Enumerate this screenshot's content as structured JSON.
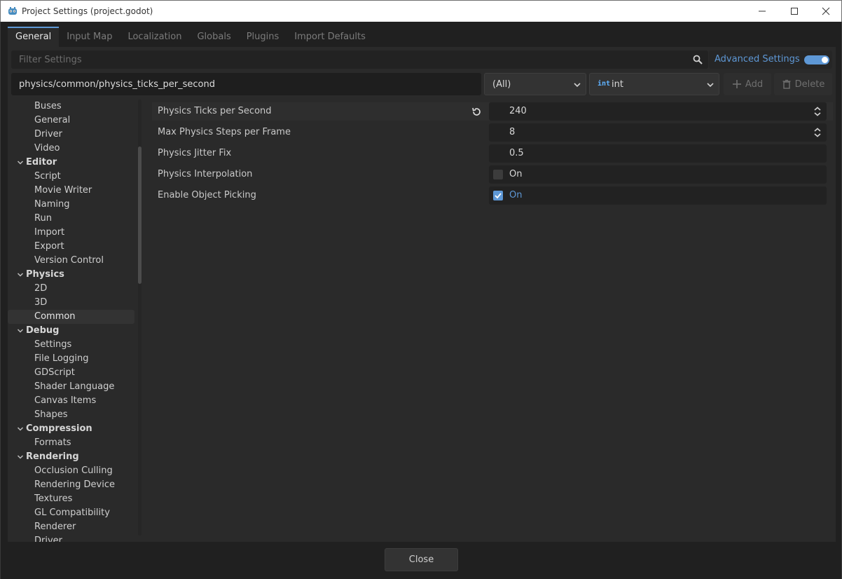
{
  "window": {
    "title": "Project Settings (project.godot)",
    "accent": "#5e98d6"
  },
  "tabs": [
    {
      "label": "General",
      "active": true
    },
    {
      "label": "Input Map"
    },
    {
      "label": "Localization"
    },
    {
      "label": "Globals"
    },
    {
      "label": "Plugins"
    },
    {
      "label": "Import Defaults"
    }
  ],
  "toolbar": {
    "filter_placeholder": "Filter Settings",
    "advanced_label": "Advanced Settings",
    "advanced_on": true,
    "path_value": "physics/common/physics_ticks_per_second",
    "filter_dropdown": "(All)",
    "type_icon": "int",
    "type_dropdown": "int",
    "add_label": "Add",
    "delete_label": "Delete"
  },
  "tree": [
    {
      "label": "Buses",
      "kind": "sub"
    },
    {
      "label": "General",
      "kind": "sub"
    },
    {
      "label": "Driver",
      "kind": "sub"
    },
    {
      "label": "Video",
      "kind": "sub"
    },
    {
      "label": "Editor",
      "kind": "cat"
    },
    {
      "label": "Script",
      "kind": "sub"
    },
    {
      "label": "Movie Writer",
      "kind": "sub"
    },
    {
      "label": "Naming",
      "kind": "sub"
    },
    {
      "label": "Run",
      "kind": "sub"
    },
    {
      "label": "Import",
      "kind": "sub"
    },
    {
      "label": "Export",
      "kind": "sub"
    },
    {
      "label": "Version Control",
      "kind": "sub"
    },
    {
      "label": "Physics",
      "kind": "cat"
    },
    {
      "label": "2D",
      "kind": "sub"
    },
    {
      "label": "3D",
      "kind": "sub"
    },
    {
      "label": "Common",
      "kind": "sub",
      "selected": true
    },
    {
      "label": "Debug",
      "kind": "cat"
    },
    {
      "label": "Settings",
      "kind": "sub"
    },
    {
      "label": "File Logging",
      "kind": "sub"
    },
    {
      "label": "GDScript",
      "kind": "sub"
    },
    {
      "label": "Shader Language",
      "kind": "sub"
    },
    {
      "label": "Canvas Items",
      "kind": "sub"
    },
    {
      "label": "Shapes",
      "kind": "sub"
    },
    {
      "label": "Compression",
      "kind": "cat"
    },
    {
      "label": "Formats",
      "kind": "sub"
    },
    {
      "label": "Rendering",
      "kind": "cat"
    },
    {
      "label": "Occlusion Culling",
      "kind": "sub"
    },
    {
      "label": "Rendering Device",
      "kind": "sub"
    },
    {
      "label": "Textures",
      "kind": "sub"
    },
    {
      "label": "GL Compatibility",
      "kind": "sub"
    },
    {
      "label": "Renderer",
      "kind": "sub"
    },
    {
      "label": "Driver",
      "kind": "sub"
    }
  ],
  "properties": [
    {
      "name": "Physics Ticks per Second",
      "value": "240",
      "type": "spin",
      "highlighted": true,
      "revertable": true
    },
    {
      "name": "Max Physics Steps per Frame",
      "value": "8",
      "type": "spin"
    },
    {
      "name": "Physics Jitter Fix",
      "value": "0.5",
      "type": "float"
    },
    {
      "name": "Physics Interpolation",
      "value": "On",
      "type": "bool",
      "checked": false
    },
    {
      "name": "Enable Object Picking",
      "value": "On",
      "type": "bool",
      "checked": true
    }
  ],
  "footer": {
    "close_label": "Close"
  }
}
